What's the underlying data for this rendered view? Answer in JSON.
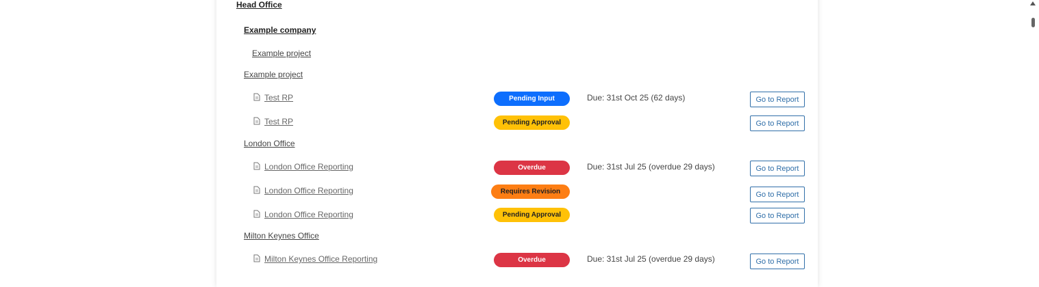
{
  "tree": {
    "head_office": "Head Office",
    "company": "Example company",
    "project_a": "Example project",
    "project_b": "Example project",
    "london_office": "London Office",
    "milton_keynes_office": "Milton Keynes Office"
  },
  "reports": [
    {
      "name": "Test RP",
      "status": "Pending Input",
      "status_color": "#0d6efd",
      "due": "Due: 31st Oct 25 (62 days)",
      "action": "Go to Report"
    },
    {
      "name": "Test RP",
      "status": "Pending Approval",
      "status_color": "#ffc107",
      "due": "",
      "action": "Go to Report"
    },
    {
      "name": "London Office Reporting",
      "status": "Overdue",
      "status_color": "#dc3545",
      "due": "Due: 31st Jul 25 (overdue 29 days)",
      "action": "Go to Report"
    },
    {
      "name": "London Office Reporting",
      "status": "Requires Revision",
      "status_color": "#fd7e14",
      "due": "",
      "action": "Go to Report"
    },
    {
      "name": "London Office Reporting",
      "status": "Pending Approval",
      "status_color": "#ffc107",
      "due": "",
      "action": "Go to Report"
    },
    {
      "name": "Milton Keynes Office Reporting",
      "status": "Overdue",
      "status_color": "#dc3545",
      "due": "Due: 31st Jul 25 (overdue 29 days)",
      "action": "Go to Report"
    }
  ],
  "icons": {
    "report": "document-icon"
  }
}
